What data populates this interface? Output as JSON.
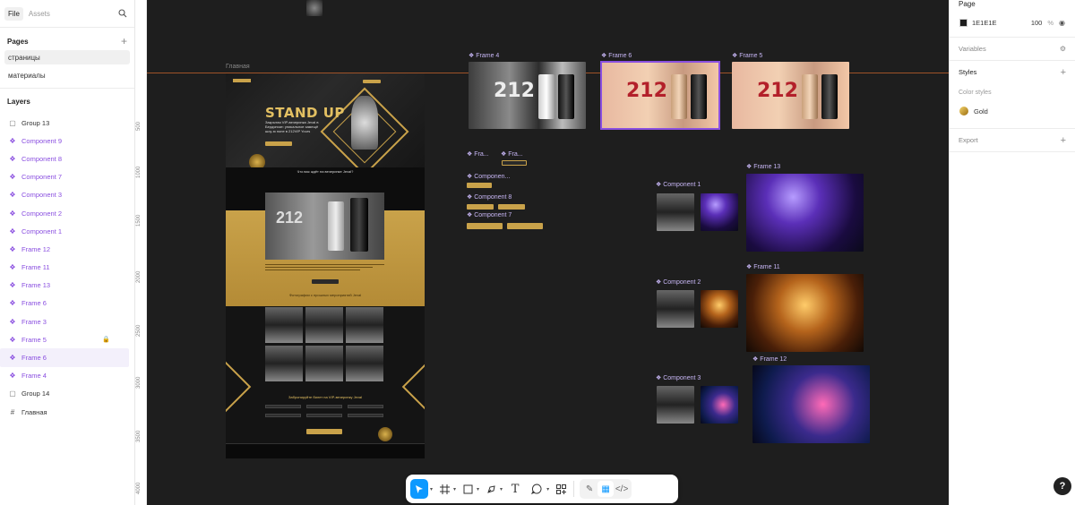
{
  "left_panel": {
    "tabs": [
      "File",
      "Assets"
    ],
    "pages_title": "Pages",
    "pages": [
      "страницы",
      "материалы"
    ],
    "layers_title": "Layers",
    "layers": [
      {
        "label": "Group 13",
        "type": "group"
      },
      {
        "label": "Component 9",
        "type": "component"
      },
      {
        "label": "Component 8",
        "type": "component"
      },
      {
        "label": "Component 7",
        "type": "component"
      },
      {
        "label": "Component 3",
        "type": "component"
      },
      {
        "label": "Component 2",
        "type": "component"
      },
      {
        "label": "Component 1",
        "type": "component"
      },
      {
        "label": "Frame 12",
        "type": "component"
      },
      {
        "label": "Frame 11",
        "type": "component"
      },
      {
        "label": "Frame 13",
        "type": "component"
      },
      {
        "label": "Frame 6",
        "type": "component"
      },
      {
        "label": "Frame 3",
        "type": "component"
      },
      {
        "label": "Frame 5",
        "type": "component",
        "locked": true
      },
      {
        "label": "Frame 6",
        "type": "component",
        "selected": true
      },
      {
        "label": "Frame 4",
        "type": "component"
      },
      {
        "label": "Group 14",
        "type": "group"
      },
      {
        "label": "Главная",
        "type": "frame"
      }
    ]
  },
  "ruler": [
    "500",
    "1000",
    "1500",
    "2000",
    "2500",
    "3000",
    "3500",
    "4000"
  ],
  "canvas": {
    "frame_labels": {
      "main": "Главная",
      "frame4": "Frame 4",
      "frame6": "Frame 6",
      "frame5": "Frame 5",
      "fra1": "Fra...",
      "fra2": "Fra...",
      "componentx": "Componen...",
      "component8": "Component 8",
      "component7": "Component 7",
      "component1": "Component 1",
      "component2": "Component 2",
      "component3": "Component 3",
      "frame13": "Frame 13",
      "frame11": "Frame 11",
      "frame12": "Frame 12"
    },
    "landing": {
      "title": "STAND UP",
      "subtitle": "Закрытая VIP-вечеринка Jeval в Бердянске: уникальное замещё шоу-ю ноне в 212VIP Yours",
      "product": "212",
      "section1": "Что вас ждёт на вечеринке Jeval?",
      "section2": "Фотографии с прошлых мероприятий Jeval",
      "section3": "Забронируйте билет на VIP-вечеринку Jeval"
    },
    "frame_text": "212"
  },
  "right_panel": {
    "page_title": "Page",
    "bg_color": "1E1E1E",
    "opacity": "100",
    "percent": "%",
    "variables": "Variables",
    "styles": "Styles",
    "color_styles": "Color styles",
    "gold_style": "Gold",
    "export": "Export"
  },
  "toolbar": {
    "tools": [
      "move",
      "frame",
      "shape",
      "pen",
      "text",
      "comment",
      "actions"
    ]
  },
  "help": "?",
  "colors": {
    "accent": "#0d99ff",
    "component": "#8a4fe0",
    "gold": "#c9a24a",
    "canvas": "#1e1e1e",
    "guide": "#c0602b"
  }
}
